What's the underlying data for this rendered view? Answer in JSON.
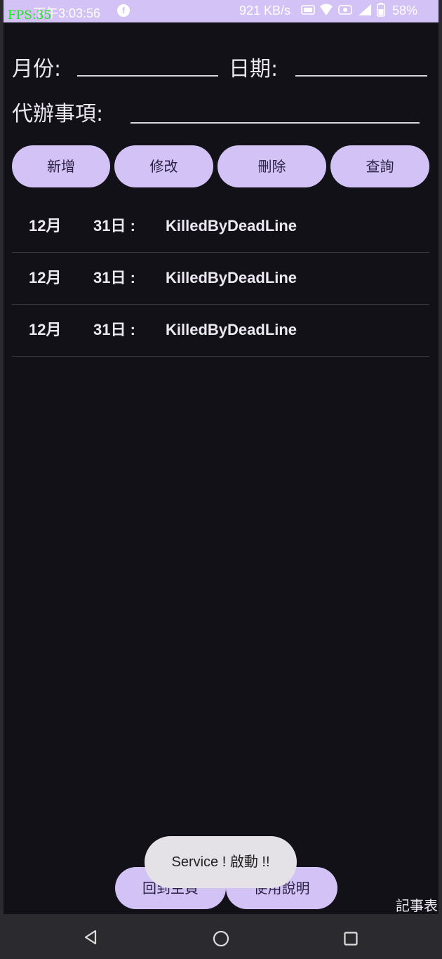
{
  "status_bar": {
    "fps": "FPS:35",
    "time": "下午3:03:56",
    "network_speed": "921 KB/s",
    "battery": "58%",
    "icons": [
      "notification-icon",
      "nfc-icon",
      "wifi-icon",
      "volte-icon",
      "signal-icon",
      "battery-icon"
    ]
  },
  "form": {
    "month_label": "月份:",
    "month_value": "",
    "day_label": "日期:",
    "day_value": "",
    "todo_label": "代辦事項:",
    "todo_value": ""
  },
  "actions": {
    "add": "新增",
    "edit": "修改",
    "delete": "刪除",
    "query": "查詢"
  },
  "records": [
    {
      "month": "12月",
      "day": "31日 :",
      "task": "KilledByDeadLine"
    },
    {
      "month": "12月",
      "day": "31日 :",
      "task": "KilledByDeadLine"
    },
    {
      "month": "12月",
      "day": "31日 :",
      "task": "KilledByDeadLine"
    }
  ],
  "bottom": {
    "home": "回到主頁",
    "help": "使用說明",
    "page_label": "記事表"
  },
  "toast": "Service ! 啟動 !!",
  "colors": {
    "accent": "#d3c2f6",
    "background": "#131118",
    "fps": "#19e619"
  }
}
